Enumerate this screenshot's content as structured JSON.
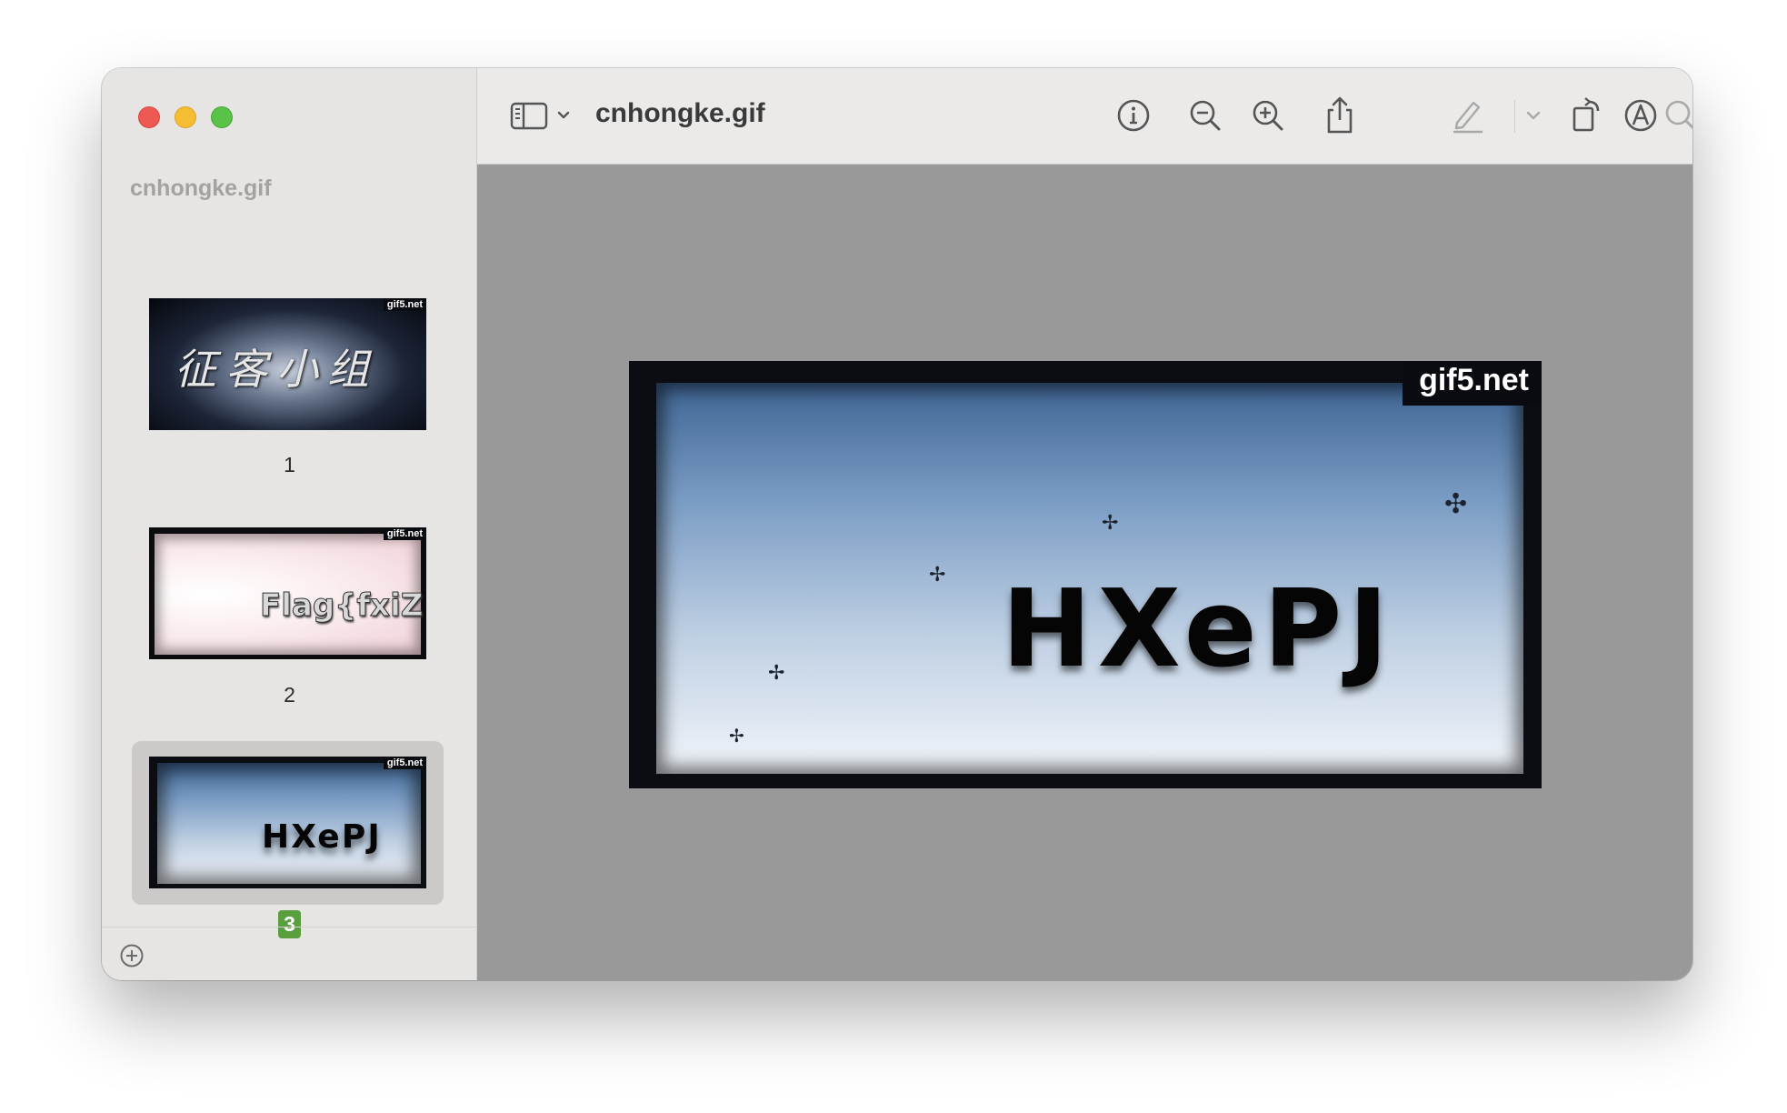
{
  "window": {
    "doc_title": "cnhongke.gif"
  },
  "sidebar": {
    "title": "cnhongke.gif",
    "pages": [
      {
        "number": "1",
        "watermark": "gif5.net",
        "caption_text": "征客小组"
      },
      {
        "number": "2",
        "watermark": "gif5.net",
        "caption_text": "Flag{fxiZ"
      },
      {
        "number": "3",
        "watermark": "gif5.net",
        "caption_text": "HXePJ",
        "selected": true
      }
    ]
  },
  "main": {
    "watermark": "gif5.net",
    "text": "HXePJ"
  },
  "toolbar": {
    "icons": [
      "sidebar-toggle-icon",
      "chevron-down-icon",
      "info-icon",
      "zoom-out-icon",
      "zoom-in-icon",
      "share-icon",
      "markup-pen-icon",
      "chevron-down-icon",
      "rotate-icon",
      "annotate-icon",
      "search-icon"
    ]
  },
  "colors": {
    "selection_badge": "#5a9f3e",
    "content_bg": "#999999",
    "close": "#ee5a53",
    "minimize": "#f5bd34",
    "maximize": "#5ac249"
  }
}
